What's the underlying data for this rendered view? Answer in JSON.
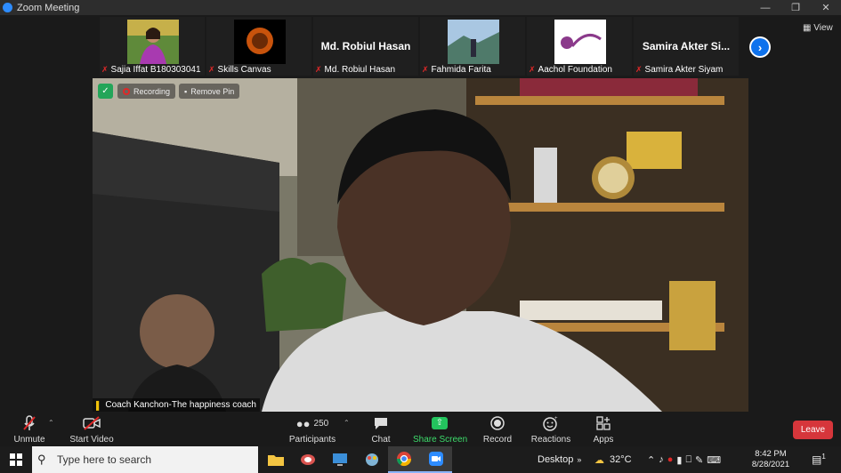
{
  "window": {
    "title": "Zoom Meeting",
    "controls": [
      "minimize",
      "maximize",
      "close"
    ]
  },
  "participants": [
    {
      "name": "Sajia Iffat B180303041",
      "display": "photo",
      "muted": true
    },
    {
      "name": "Skills Canvas",
      "display": "logo",
      "muted": true
    },
    {
      "name": "Md. Robiul Hasan",
      "display": "name",
      "muted": true
    },
    {
      "name": "Fahmida Farita",
      "display": "photo",
      "muted": true
    },
    {
      "name": "Aachol Foundation",
      "display": "logo",
      "muted": true
    },
    {
      "name": "Samira Akter Siyam",
      "display": "name",
      "display_name": "Samira Akter Si...",
      "muted": true
    }
  ],
  "strip": {
    "view_label": "View",
    "next_icon": "chevron-right-icon"
  },
  "main_video": {
    "recording_label": "Recording",
    "remove_pin_label": "Remove Pin",
    "speaker_name": "Coach Kanchon-The happiness coach"
  },
  "controls": {
    "unmute": "Unmute",
    "start_video": "Start Video",
    "participants": "Participants",
    "participant_count": "250",
    "chat": "Chat",
    "share_screen": "Share Screen",
    "record": "Record",
    "reactions": "Reactions",
    "apps": "Apps",
    "leave": "Leave"
  },
  "taskbar": {
    "search_placeholder": "Type here to search",
    "desktop_label": "Desktop",
    "temperature": "32°C",
    "time": "8:42 PM",
    "date": "8/28/2021",
    "notification_count": "1"
  },
  "colors": {
    "zoom_blue": "#0e72ed",
    "share_green": "#23c45e",
    "leave_red": "#d6363b",
    "mute_red": "#e02828"
  }
}
